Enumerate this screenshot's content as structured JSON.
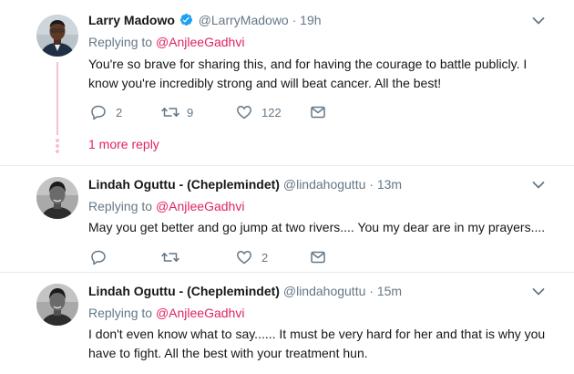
{
  "colors": {
    "accent": "#e0245e",
    "muted": "#657786",
    "verified": "#1da1f2"
  },
  "tweets": [
    {
      "name": "Larry Madowo",
      "verified": true,
      "handle": "@LarryMadowo",
      "separator": "·",
      "time": "19h",
      "replying_label": "Replying to",
      "replying_to": "@AnjleeGadhvi",
      "text": "You're so brave for sharing this, and for having the courage to battle publicly. I know you're incredibly strong and will beat cancer. All the best!",
      "reply_count": "2",
      "retweet_count": "9",
      "like_count": "122",
      "more_replies": "1 more reply"
    },
    {
      "name": "Lindah Oguttu - (Cheplemindet)",
      "handle": "@lindahoguttu",
      "separator": "·",
      "time": "13m",
      "replying_label": "Replying to",
      "replying_to": "@AnjleeGadhvi",
      "text": "May you get better and go jump at two rivers.... You my dear are in my prayers....",
      "reply_count": "",
      "retweet_count": "",
      "like_count": "2"
    },
    {
      "name": "Lindah Oguttu - (Cheplemindet)",
      "handle": "@lindahoguttu",
      "separator": "·",
      "time": "15m",
      "replying_label": "Replying to",
      "replying_to": "@AnjleeGadhvi",
      "text": "I don't even know what to say...... It must be very hard for her and that is why you have to fight. All the best with your treatment hun."
    }
  ],
  "icons": [
    "reply-icon",
    "retweet-icon",
    "like-icon",
    "message-icon",
    "chevron-down-icon",
    "verified-icon"
  ]
}
